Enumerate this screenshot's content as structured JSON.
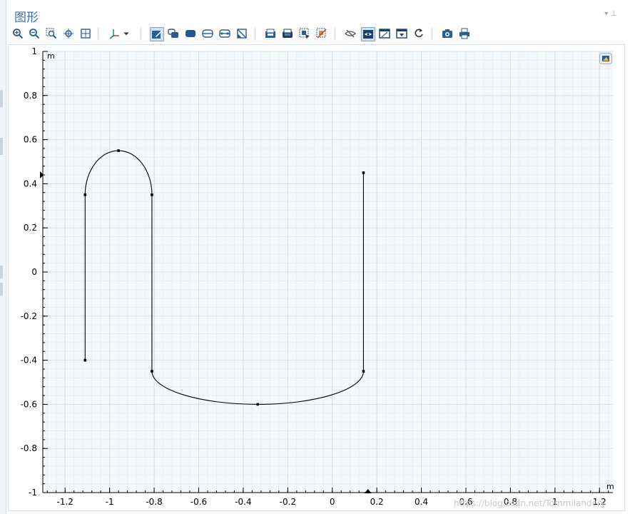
{
  "window": {
    "title": "图形",
    "actions": [
      "▾",
      "⊥"
    ]
  },
  "toolbar": {
    "buttons": [
      {
        "name": "zoom-in-icon",
        "tooltip": ""
      },
      {
        "name": "zoom-out-icon"
      },
      {
        "name": "zoom-box-icon"
      },
      {
        "name": "zoom-selected-icon"
      },
      {
        "name": "zoom-extents-icon"
      },
      {
        "name": "axis-orientation-icon"
      },
      {
        "name": "chevron-down-icon"
      },
      {
        "name": "select-objects-icon"
      },
      {
        "name": "select-domains-icon"
      },
      {
        "name": "select-boundaries-icon"
      },
      {
        "name": "select-edges-icon"
      },
      {
        "name": "select-points-icon"
      },
      {
        "name": "clear-selection-icon"
      },
      {
        "name": "build-selected-icon"
      },
      {
        "name": "build-all-icon"
      },
      {
        "name": "select-box-icon"
      },
      {
        "name": "deselect-icon"
      },
      {
        "name": "hide-icon"
      },
      {
        "name": "show-icon"
      },
      {
        "name": "transparency-icon"
      },
      {
        "name": "scene-light-icon"
      },
      {
        "name": "reset-view-icon"
      },
      {
        "name": "camera-icon"
      },
      {
        "name": "print-icon"
      }
    ]
  },
  "plot": {
    "unit_x": "m",
    "unit_y": "m",
    "x_ticks": [
      "-1.2",
      "-1",
      "-0.8",
      "-0.6",
      "-0.4",
      "-0.2",
      "0",
      "0.2",
      "0.4",
      "0.6",
      "0.8",
      "1",
      "1.2"
    ],
    "y_ticks": [
      "1",
      "0.8",
      "0.6",
      "0.4",
      "0.2",
      "0",
      "-0.2",
      "-0.4",
      "-0.6",
      "-0.8",
      "-1"
    ],
    "xlim": [
      -1.3,
      1.26
    ],
    "ylim": [
      -1.0,
      1.0
    ],
    "grid": true,
    "colors": {
      "background": "#f4f8fb",
      "grid_major": "#d5e1ea",
      "grid_minor": "#e7eef3",
      "geometry": "#000000",
      "axis": "#000000"
    }
  },
  "chart_data": {
    "type": "line",
    "x_unit": "m",
    "y_unit": "m",
    "grid": true,
    "xlim": [
      -1.3,
      1.26
    ],
    "ylim": [
      -1.0,
      1.0
    ],
    "vertices": [
      {
        "x": -1.11,
        "y": -0.4
      },
      {
        "x": -1.11,
        "y": 0.35
      },
      {
        "x": -0.96,
        "y": 0.55
      },
      {
        "x": -0.81,
        "y": 0.35
      },
      {
        "x": -0.81,
        "y": -0.45
      },
      {
        "x": -0.335,
        "y": -0.6
      },
      {
        "x": 0.14,
        "y": -0.45
      },
      {
        "x": 0.14,
        "y": 0.45
      }
    ],
    "edges": [
      {
        "kind": "segment",
        "from": 0,
        "to": 1
      },
      {
        "kind": "arc",
        "from": 1,
        "to": 3,
        "through": 2
      },
      {
        "kind": "segment",
        "from": 3,
        "to": 4
      },
      {
        "kind": "arc",
        "from": 4,
        "to": 6,
        "through": 5
      },
      {
        "kind": "segment",
        "from": 6,
        "to": 7
      }
    ]
  },
  "footer": {
    "watermark": "https://blog.csdn.net/Tommilandery"
  }
}
